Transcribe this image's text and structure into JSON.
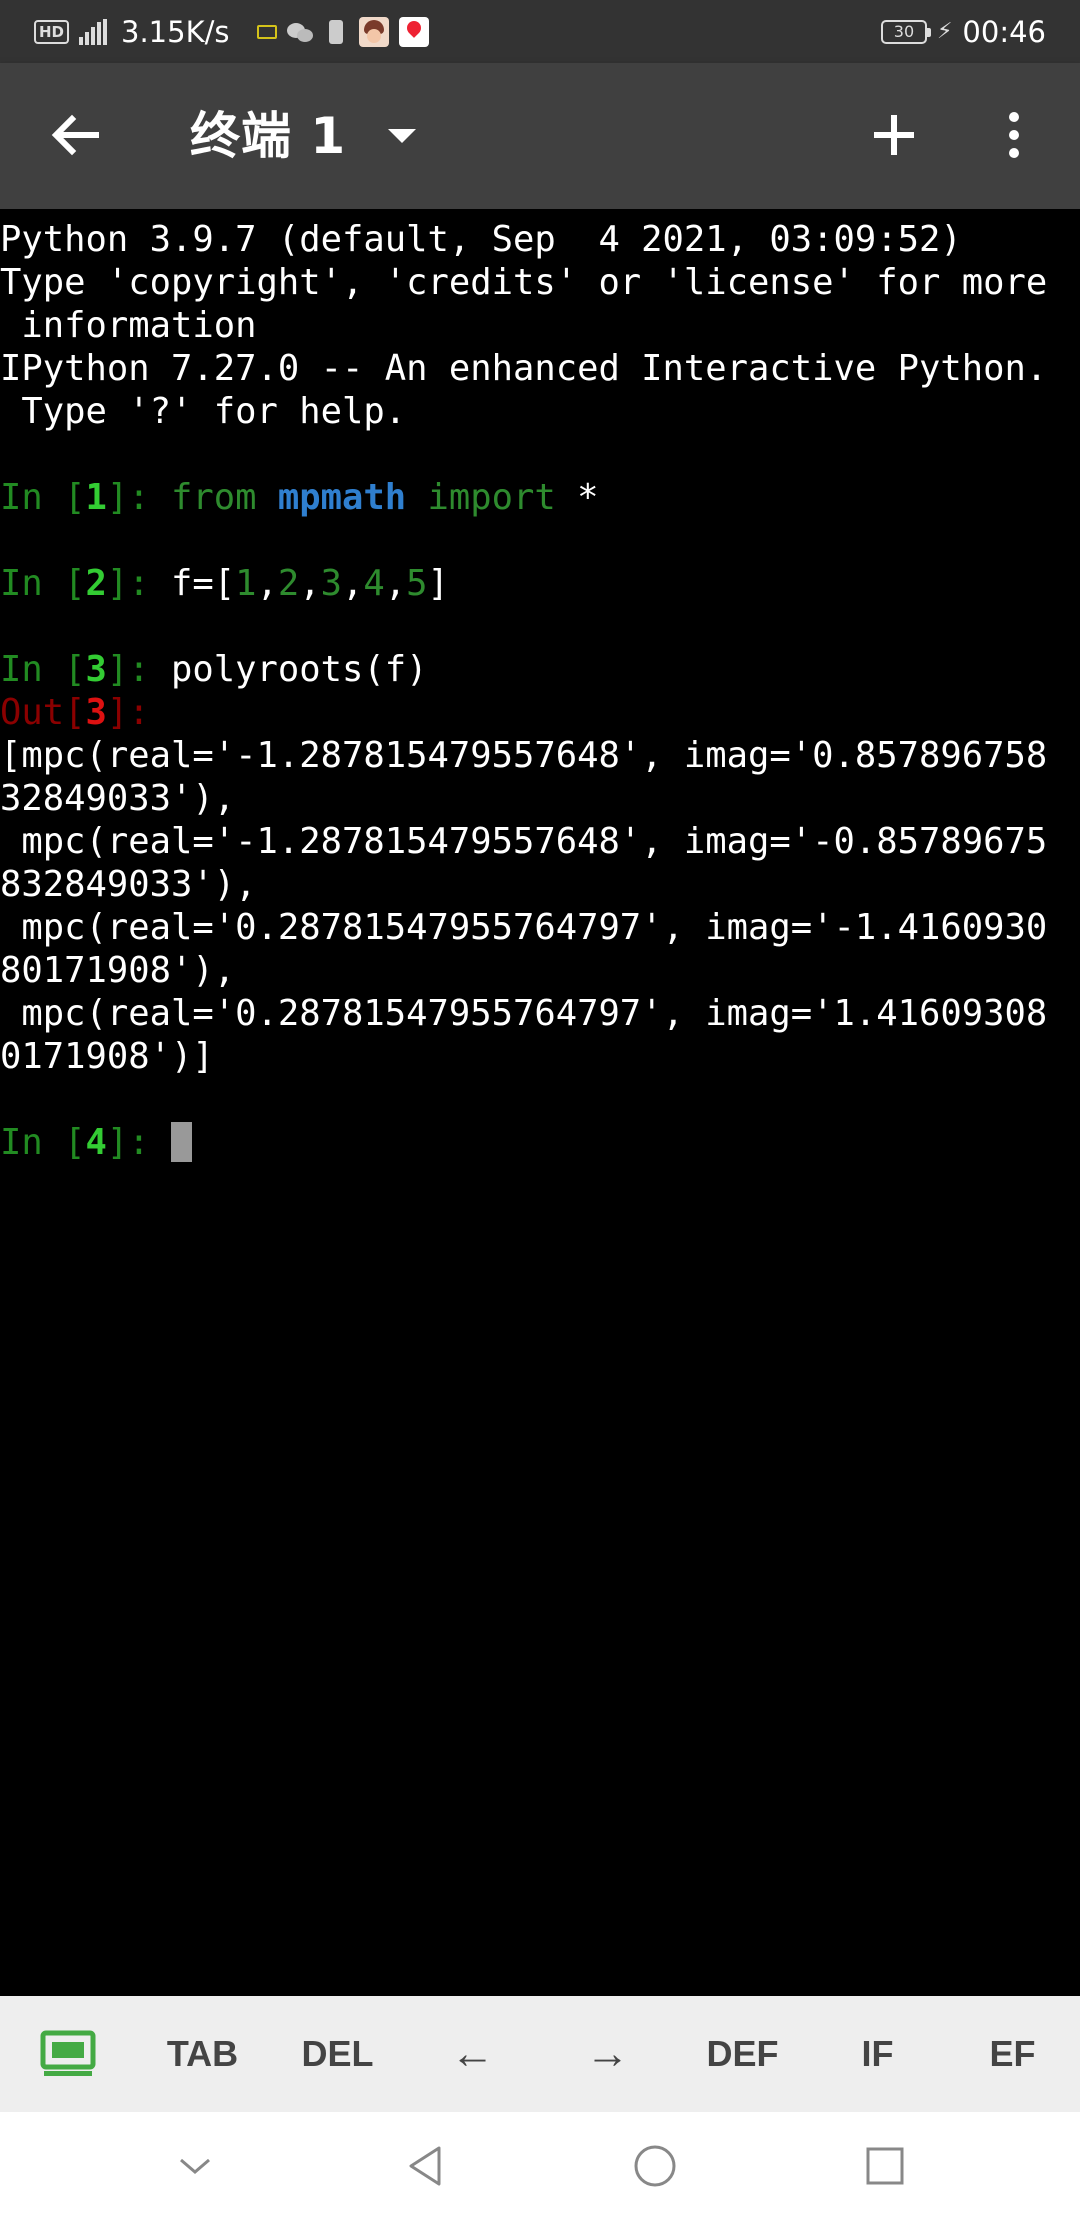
{
  "status_bar": {
    "hd": "HD",
    "network_speed": "3.15K/s",
    "battery_level": "30",
    "time": "00:46"
  },
  "app_bar": {
    "title": "终端 1"
  },
  "terminal": {
    "header_lines": [
      "Python 3.9.7 (default, Sep  4 2021, 03:09:52)",
      "Type 'copyright', 'credits' or 'license' for more",
      " information",
      "IPython 7.27.0 -- An enhanced Interactive Python.",
      " Type '?' for help."
    ],
    "in1": {
      "pre": "In [",
      "num": "1",
      "post": "]: ",
      "kw1": "from",
      "mod": "mpmath",
      "kw2": "import",
      "rest": " *"
    },
    "in2": {
      "pre": "In [",
      "num": "2",
      "post": "]: ",
      "code_a": "f=[",
      "n1": "1",
      "n2": "2",
      "n3": "3",
      "n4": "4",
      "n5": "5",
      "comma": ",",
      "code_b": "]"
    },
    "in3": {
      "pre": "In [",
      "num": "3",
      "post": "]: ",
      "code": "polyroots(f)"
    },
    "out3": {
      "pre": "Out[",
      "num": "3",
      "post": "]:"
    },
    "output_lines": [
      "[mpc(real='-1.287815479557648', imag='0.857896758",
      "32849033'),",
      " mpc(real='-1.287815479557648', imag='-0.85789675",
      "832849033'),",
      " mpc(real='0.28781547955764797', imag='-1.4160930",
      "80171908'),",
      " mpc(real='0.28781547955764797', imag='1.41609308",
      "0171908')]"
    ],
    "in4": {
      "pre": "In [",
      "num": "4",
      "post": "]: "
    }
  },
  "extra_keys": [
    {
      "label": "TAB"
    },
    {
      "label": "DEL"
    },
    {
      "label": "←"
    },
    {
      "label": "→"
    },
    {
      "label": "DEF"
    },
    {
      "label": "IF"
    },
    {
      "label": "EF"
    }
  ],
  "colors": {
    "prompt_in": "#228b22",
    "prompt_out": "#8b0000",
    "module": "#2f7fcf",
    "keyboard_icon": "#44aa44"
  }
}
